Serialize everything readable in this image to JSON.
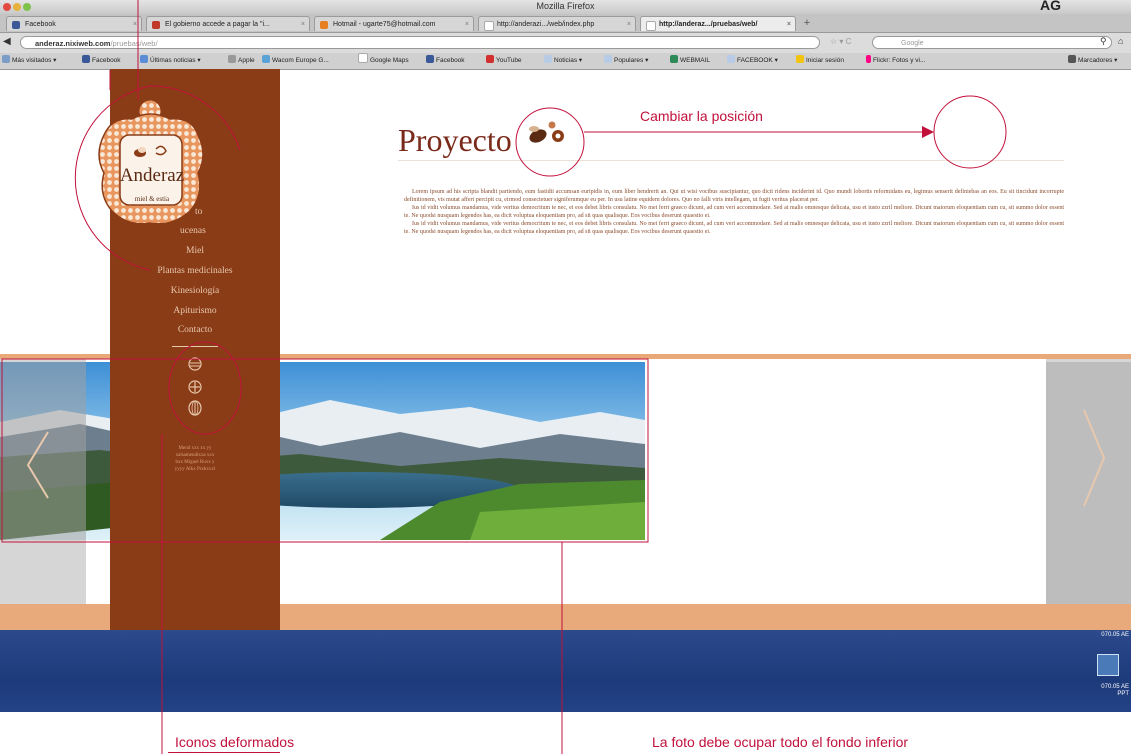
{
  "browser": {
    "title": "Mozilla Firefox",
    "corner_text": "AG",
    "tabs": [
      {
        "label": "Facebook",
        "fav": "#3b5998"
      },
      {
        "label": "El gobierno accede a pagar la \"i...",
        "fav": "#c0392b"
      },
      {
        "label": "Hotmail - ugarte75@hotmail.com",
        "fav": "#e67e22"
      },
      {
        "label": "http://anderazi.../web/index.php",
        "fav": "#ffffff"
      },
      {
        "label": "http://anderaz.../pruebas/web/",
        "fav": "#ffffff"
      }
    ],
    "new_tab_label": "+",
    "url": {
      "domain": "anderaz.nixiweb.com",
      "path": "/pruebas/web/",
      "prefix": "anderaz."
    },
    "search_placeholder": "Google",
    "bookmarks": [
      "Más visitados",
      "Facebook",
      "Últimas noticias",
      "Apple",
      "Wacom Europe G...",
      "Google Maps",
      "Facebook",
      "YouTube",
      "Noticias",
      "Populares",
      "WEBMAIL",
      "FACEBOOK",
      "Iniciar sesión",
      "Flickr: Fotos y vi...",
      "Marcadores"
    ]
  },
  "site": {
    "logo": {
      "name": "Anderaz",
      "tagline": "miel & estia"
    },
    "page_title": "Proyecto",
    "menu": [
      {
        "label": "to"
      },
      {
        "label": "ucenas"
      },
      {
        "label": "Miel"
      },
      {
        "label": "Plantas medicinales"
      },
      {
        "label": "Kinesiología"
      },
      {
        "label": "Apiturismo"
      },
      {
        "label": "Contacto"
      }
    ],
    "address": "Mend xxx xx yy\nxalsamendixxa xxx\nbxx Miguel Ruxx y\nyyyy Alkx Prxkxxxl",
    "body_paragraphs": [
      "Lorem ipsum ad his scripta blandit partiendo, eum fastidii accumsan euripidis in, eum liber hendrerit an. Qui ut wisi vocibus suscipiantur, quo dicit ridens inciderint id. Quo mundi lobortis reformidans eu, legimus senserit definiebas an eos. Eu sit tincidunt incorrupte definitionem, vis mutat affert percipit cu, eirmod consectetuer signiferumque eu per. In usu latine equidem dolores. Quo no falli viris intellegam, ut fugit veritus placerat per.",
      "Ius id vidit volumus mandamus, vide veritus democritum te nec, ei eos debet libris consulatu. No mei ferri graeco dicunt, ad cum veri accommodare. Sed at malis omnesque delicata, usu et iusto zzril meliore. Dicunt maiorum eloquentiam cum cu, sit summo dolor essent te. Ne quodsi nusquam legendos has, ea dicit voluptua eloquentiam pro, ad sit quas qualisque. Eos vocibus deserunt quaestio ei.",
      "Ius id vidit volumus mandamus, vide veritus democritum te nec, ei eos debet libris consulatu. No mei ferri graeco dicunt, ad cum veri accommodare. Sed at malis omnesque delicata, usu et iusto zzril meliore. Dicunt maiorum eloquentiam cum cu, sit summo dolor essent te. Ne quodsi nusquam legendos has, ea dicit voluptua eloquentiam pro, ad sit quas qualisque. Eos vocibus deserunt quaestio ei."
    ]
  },
  "desktop": {
    "clock1": "070.05 AE",
    "clock2": "070.05 AE",
    "clock2b": "PPT"
  },
  "annotations": {
    "move_position": "Cambiar la posición",
    "icons_deformed": "Iconos deformados",
    "photo_bg": "La foto debe ocupar todo el fondo inferior"
  },
  "colors": {
    "brown": "#8a3c17",
    "annotation_red": "#c1113b",
    "title_brown": "#7a2a1a",
    "peach": "#e8aa7a"
  }
}
